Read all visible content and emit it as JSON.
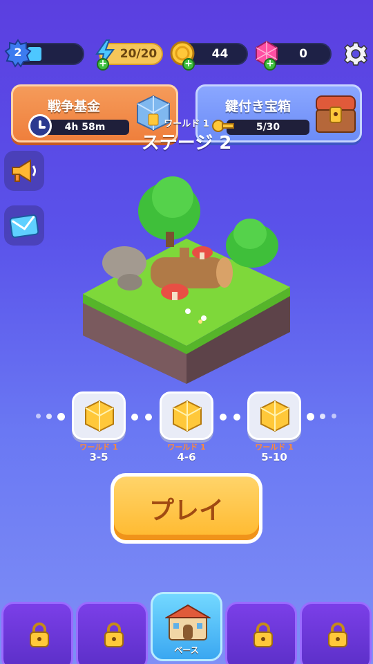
{
  "resources": {
    "level": "2",
    "energy": "20/20",
    "coins": "44",
    "gems": "0"
  },
  "events": {
    "war_fund": {
      "title": "戦争基金",
      "timer": "4h 58m"
    },
    "locked_chest": {
      "title": "鍵付き宝箱",
      "progress": "5/30",
      "progress_fraction": 0.1667
    }
  },
  "stage": {
    "world": "ワールド 1",
    "title": "ステージ 2"
  },
  "levels": [
    {
      "world": "ワールド 1",
      "stage": "3-5"
    },
    {
      "world": "ワールド 1",
      "stage": "4-6"
    },
    {
      "world": "ワールド 1",
      "stage": "5-10"
    }
  ],
  "play_label": "プレイ",
  "nav": {
    "base_label": "ベース"
  },
  "colors": {
    "coin": "#ffc83a",
    "gem": "#ff4fa3",
    "energy": "#4dc7ff",
    "plus": "#3fbf3f",
    "play": "#ffb92e"
  },
  "icons": [
    "level-badge-icon",
    "lightning-icon",
    "coin-icon",
    "gem-icon",
    "gear-icon",
    "treasure-cube-icon",
    "chest-icon",
    "megaphone-icon",
    "mail-icon",
    "lock-icon",
    "castle-icon"
  ]
}
